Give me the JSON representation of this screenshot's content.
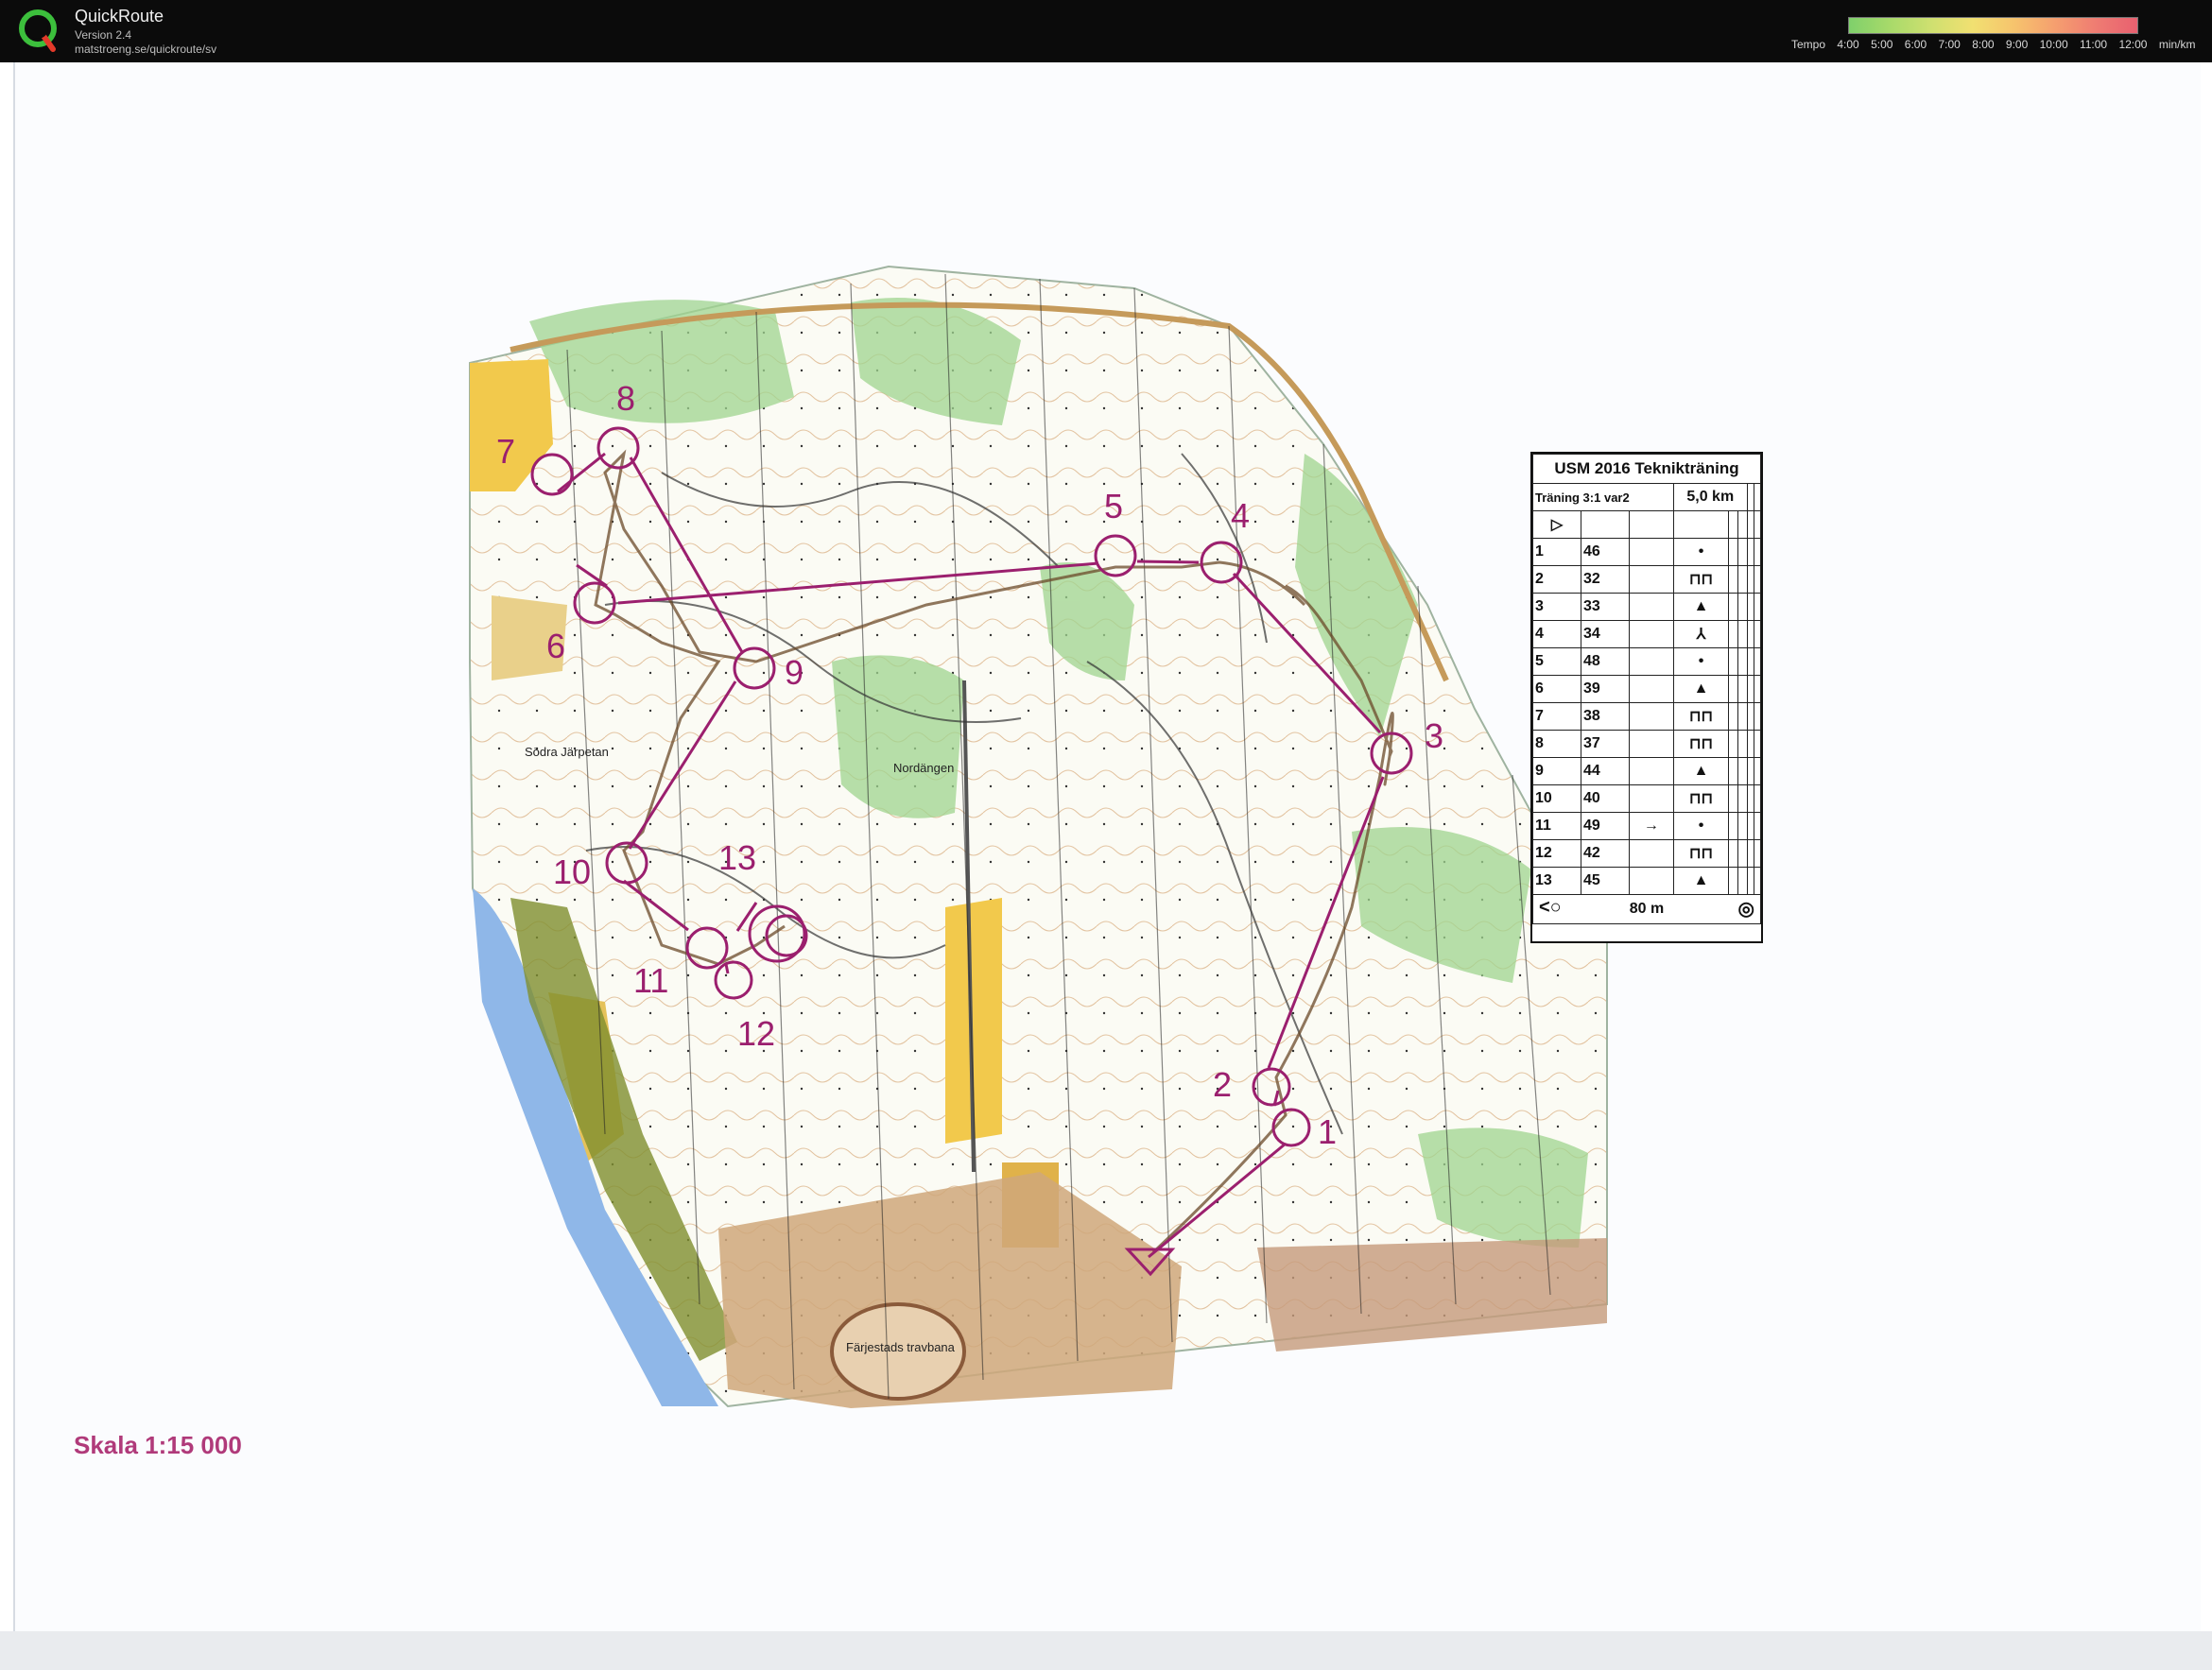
{
  "app": {
    "title": "QuickRoute",
    "version": "Version 2.4",
    "url": "matstroeng.se/quickroute/sv"
  },
  "tempo_legend": {
    "label": "Tempo",
    "ticks": [
      "4:00",
      "5:00",
      "6:00",
      "7:00",
      "8:00",
      "9:00",
      "10:00",
      "11:00",
      "12:00"
    ],
    "unit": "min/km",
    "colors": [
      "#7fd06b",
      "#a8da6a",
      "#cfe070",
      "#f1e071",
      "#f6c46d",
      "#f59f6f",
      "#ef7c72",
      "#e86070"
    ]
  },
  "map": {
    "route_color": "#9b1f6e",
    "gps_color": "#7a4a2a",
    "place_names": [
      "Södra Järpetan",
      "Nordängen",
      "Färjestads travbana"
    ],
    "controls": [
      {
        "num": "1"
      },
      {
        "num": "2"
      },
      {
        "num": "3"
      },
      {
        "num": "4"
      },
      {
        "num": "5"
      },
      {
        "num": "6"
      },
      {
        "num": "7"
      },
      {
        "num": "8"
      },
      {
        "num": "9"
      },
      {
        "num": "10"
      },
      {
        "num": "11"
      },
      {
        "num": "12"
      },
      {
        "num": "13"
      }
    ]
  },
  "description_sheet": {
    "title": "USM 2016 Teknikträning",
    "class": "Träning 3:1 var2",
    "distance": "5,0 km",
    "start_symbol": "▷",
    "rows": [
      {
        "num": "1",
        "code": "46",
        "dir": "",
        "symbol": "•"
      },
      {
        "num": "2",
        "code": "32",
        "dir": "",
        "symbol": "⊓⊓"
      },
      {
        "num": "3",
        "code": "33",
        "dir": "",
        "symbol": "▲"
      },
      {
        "num": "4",
        "code": "34",
        "dir": "",
        "symbol": "⅄"
      },
      {
        "num": "5",
        "code": "48",
        "dir": "",
        "symbol": "•"
      },
      {
        "num": "6",
        "code": "39",
        "dir": "",
        "symbol": "▲"
      },
      {
        "num": "7",
        "code": "38",
        "dir": "",
        "symbol": "⊓⊓"
      },
      {
        "num": "8",
        "code": "37",
        "dir": "",
        "symbol": "⊓⊓"
      },
      {
        "num": "9",
        "code": "44",
        "dir": "",
        "symbol": "▲"
      },
      {
        "num": "10",
        "code": "40",
        "dir": "",
        "symbol": "⊓⊓"
      },
      {
        "num": "11",
        "code": "49",
        "dir": "→",
        "symbol": "•"
      },
      {
        "num": "12",
        "code": "42",
        "dir": "",
        "symbol": "⊓⊓"
      },
      {
        "num": "13",
        "code": "45",
        "dir": "",
        "symbol": "▲"
      }
    ],
    "finish_distance": "80 m"
  },
  "scale_label": "Skala 1:15 000"
}
